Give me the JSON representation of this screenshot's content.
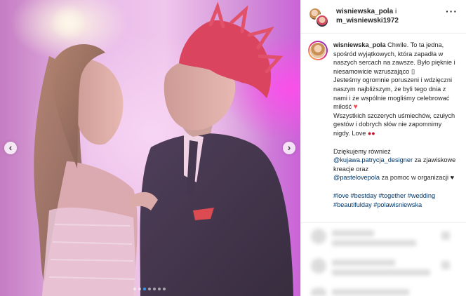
{
  "post": {
    "header": {
      "user1": "wisniewska_pola",
      "separator": "i",
      "user2": "m_wisniewski1972",
      "more_icon": "more-dots-icon"
    },
    "caption": {
      "username": "wisniewska_pola",
      "line1": "Chwile. To ta jedna, spośród wyjątkowych, która zapadła w naszych sercach na zawsze. Było pięknie i niesamowicie wzruszająco",
      "line2": "Jesteśmy ogromnie poruszeni i wdzięczni naszym najbliższym, że byli tego dnia z nami i że wspólnie mogliśmy celebrować miłość",
      "line3": "Wszystkich szczerych uśmiechów, czułych gestów i dobrych słów nie zapomnimy nigdy. Love",
      "thanks_prefix": "Dziękujemy również",
      "mention1": "@kujawa.patrycja_designer",
      "thanks_mid": "za zjawiskowe kreacje oraz",
      "mention2": "@pastelovepola",
      "thanks_suffix": "za pomoc w organizacji ♥",
      "hashtags": "#love #bestday #together #wedding #beautifulday #polawisniewska"
    },
    "carousel": {
      "total_slides": 7,
      "active_slide": 3,
      "prev_label": "‹",
      "next_label": "›"
    },
    "icons": [
      "heart-emoji-icon",
      "cherry-emoji-icon",
      "prev-arrow-icon",
      "next-arrow-icon"
    ]
  }
}
